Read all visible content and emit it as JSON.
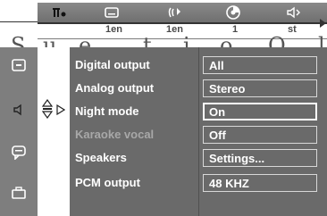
{
  "top_tabs": [
    {
      "icon": "audio-language-icon",
      "label": ""
    },
    {
      "icon": "subtitle-icon",
      "label": "1en"
    },
    {
      "icon": "angle-icon",
      "label": "1en"
    },
    {
      "icon": "disc-icon",
      "label": "1"
    },
    {
      "icon": "sound-icon",
      "label": "st"
    }
  ],
  "sub_labels": [
    "1en",
    "1en",
    "1",
    "st"
  ],
  "banner_text": [
    "S",
    "u",
    "e",
    "t",
    "i",
    "o",
    "O",
    "l"
  ],
  "sidebar": [
    {
      "icon": "display-icon"
    },
    {
      "icon": "speaker-icon"
    },
    {
      "icon": "chat-icon"
    },
    {
      "icon": "briefcase-icon"
    }
  ],
  "menu": [
    {
      "label": "Digital output",
      "value": "All",
      "selected": false,
      "enabled": true
    },
    {
      "label": "Analog output",
      "value": "Stereo",
      "selected": false,
      "enabled": true
    },
    {
      "label": "Night mode",
      "value": "On",
      "selected": true,
      "enabled": true
    },
    {
      "label": "Karaoke vocal",
      "value": "Off",
      "selected": false,
      "enabled": false
    },
    {
      "label": "Speakers",
      "value": "Settings...",
      "selected": false,
      "enabled": true
    },
    {
      "label": "PCM output",
      "value": "48 KHZ",
      "selected": false,
      "enabled": true
    }
  ]
}
